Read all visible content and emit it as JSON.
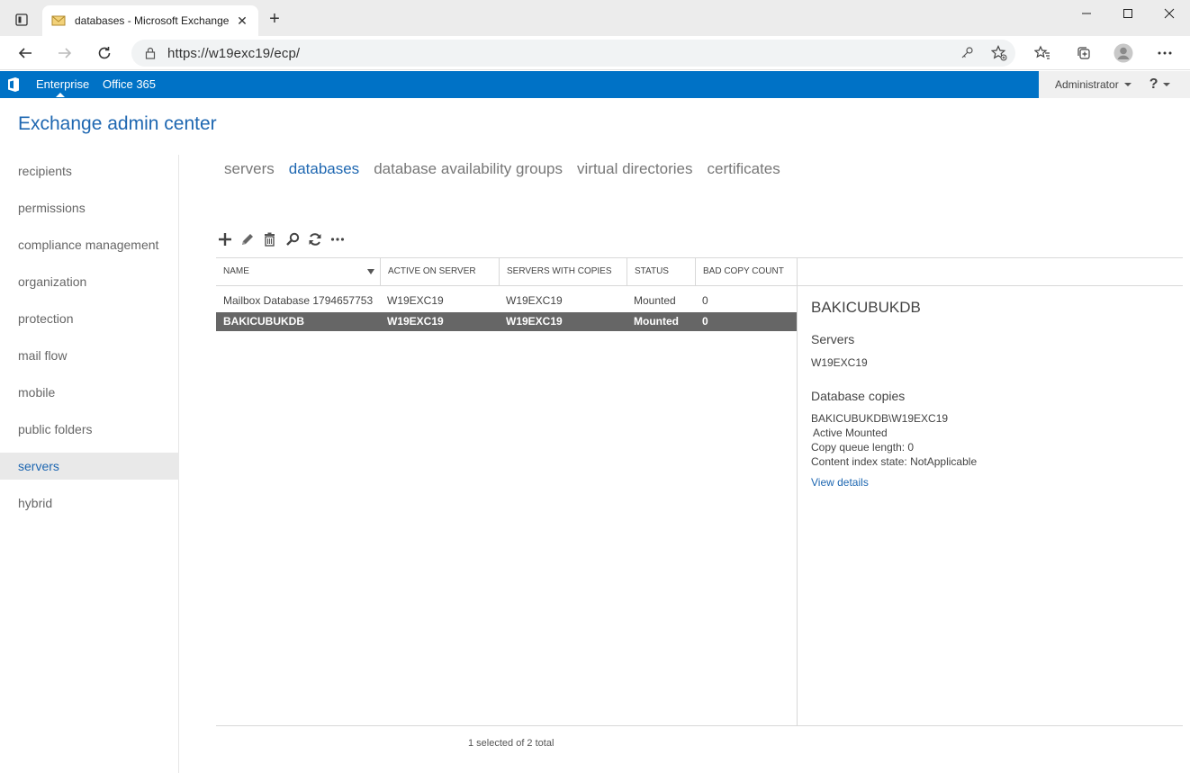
{
  "browser": {
    "tab_title": "databases - Microsoft Exchange",
    "url": "https://w19exc19/ecp/"
  },
  "o365": {
    "enterprise": "Enterprise",
    "office365": "Office 365",
    "user": "Administrator",
    "help": "?"
  },
  "eac": {
    "title": "Exchange admin center"
  },
  "nav": {
    "items": [
      {
        "label": "recipients"
      },
      {
        "label": "permissions"
      },
      {
        "label": "compliance management"
      },
      {
        "label": "organization"
      },
      {
        "label": "protection"
      },
      {
        "label": "mail flow"
      },
      {
        "label": "mobile"
      },
      {
        "label": "public folders"
      },
      {
        "label": "servers",
        "selected": true
      },
      {
        "label": "hybrid"
      }
    ]
  },
  "subtabs": [
    {
      "label": "servers"
    },
    {
      "label": "databases",
      "active": true
    },
    {
      "label": "database availability groups"
    },
    {
      "label": "virtual directories"
    },
    {
      "label": "certificates"
    }
  ],
  "toolbar_icons": [
    "add-icon",
    "edit-icon",
    "delete-icon",
    "search-icon",
    "refresh-icon",
    "more-icon"
  ],
  "table": {
    "columns": [
      "NAME",
      "ACTIVE ON SERVER",
      "SERVERS WITH COPIES",
      "STATUS",
      "BAD COPY COUNT"
    ],
    "rows": [
      {
        "name": "Mailbox Database 1794657753",
        "active": "W19EXC19",
        "copies": "W19EXC19",
        "status": "Mounted",
        "bad": "0",
        "selected": false
      },
      {
        "name": "BAKICUBUKDB",
        "active": "W19EXC19",
        "copies": "W19EXC19",
        "status": "Mounted",
        "bad": "0",
        "selected": true
      }
    ]
  },
  "details": {
    "title": "BAKICUBUKDB",
    "servers_heading": "Servers",
    "servers_value": "W19EXC19",
    "copies_heading": "Database copies",
    "copy_name": "BAKICUBUKDB\\W19EXC19",
    "copy_status": "Active Mounted",
    "copy_queue": "Copy queue length:  0",
    "content_index": "Content index state:  NotApplicable",
    "view_details": "View details"
  },
  "status_text": "1 selected of 2 total",
  "colors": {
    "accent": "#1e67b1",
    "o365_bar": "#0072c6",
    "selected_row": "#666666"
  }
}
